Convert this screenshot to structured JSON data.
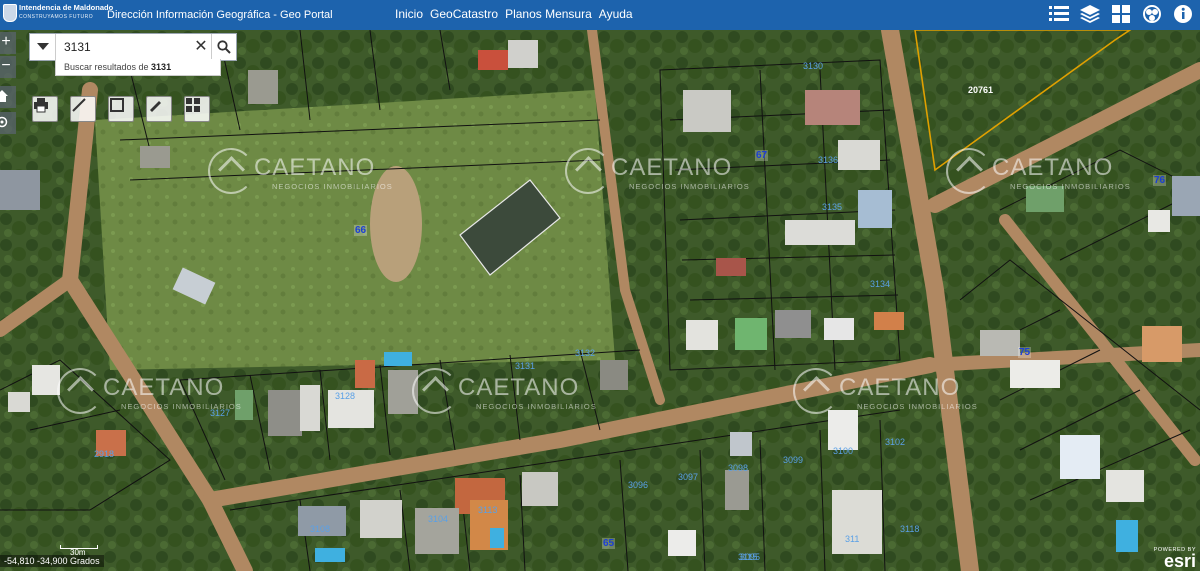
{
  "header": {
    "logo_line1": "Intendencia de Maldonado",
    "logo_line2": "CONSTRUYAMOS FUTURO",
    "app_title": "Dirección Información Geográfica - Geo Portal",
    "nav": [
      "Inicio",
      "GeoCatastro",
      "Planos Mensura",
      "Ayuda"
    ],
    "tools": [
      "list-icon",
      "layers-icon",
      "basemap-gallery-icon",
      "legend-icon",
      "info-icon"
    ]
  },
  "search": {
    "value": "3131",
    "suggestion_prefix": "Buscar resultados de ",
    "suggestion_term": "3131"
  },
  "zoom": {
    "in": "+",
    "out": "−"
  },
  "map": {
    "parcels": [
      {
        "label": "3130"
      },
      {
        "label": "3136"
      },
      {
        "label": "3135"
      },
      {
        "label": "3134"
      },
      {
        "label": "3132"
      },
      {
        "label": "3131"
      },
      {
        "label": "3128"
      },
      {
        "label": "3127"
      },
      {
        "label": "3102"
      },
      {
        "label": "3100"
      },
      {
        "label": "3099"
      },
      {
        "label": "3098"
      },
      {
        "label": "3097"
      },
      {
        "label": "3096"
      },
      {
        "label": "3095"
      },
      {
        "label": "3104"
      },
      {
        "label": "3108"
      },
      {
        "label": "3113"
      },
      {
        "label": "311"
      },
      {
        "label": "3118"
      },
      {
        "label": "3115"
      },
      {
        "label": "2918"
      },
      {
        "label": "20761"
      }
    ],
    "blocks": [
      "66",
      "67",
      "76",
      "75",
      "65"
    ],
    "watermark_name": "CAETANO",
    "watermark_sub": "NEGOCIOS INMOBILIARIOS",
    "coordinates": "-54,810 -34,900 Grados",
    "scale_label": "30m",
    "attribution_line1": "POWERED BY",
    "attribution_line2": "esri"
  },
  "colors": {
    "header": "#1d63ad",
    "block_label": "#1c3fd6",
    "parcel_label": "#5aa0e6",
    "highlight_parcel": "#e0a000"
  }
}
